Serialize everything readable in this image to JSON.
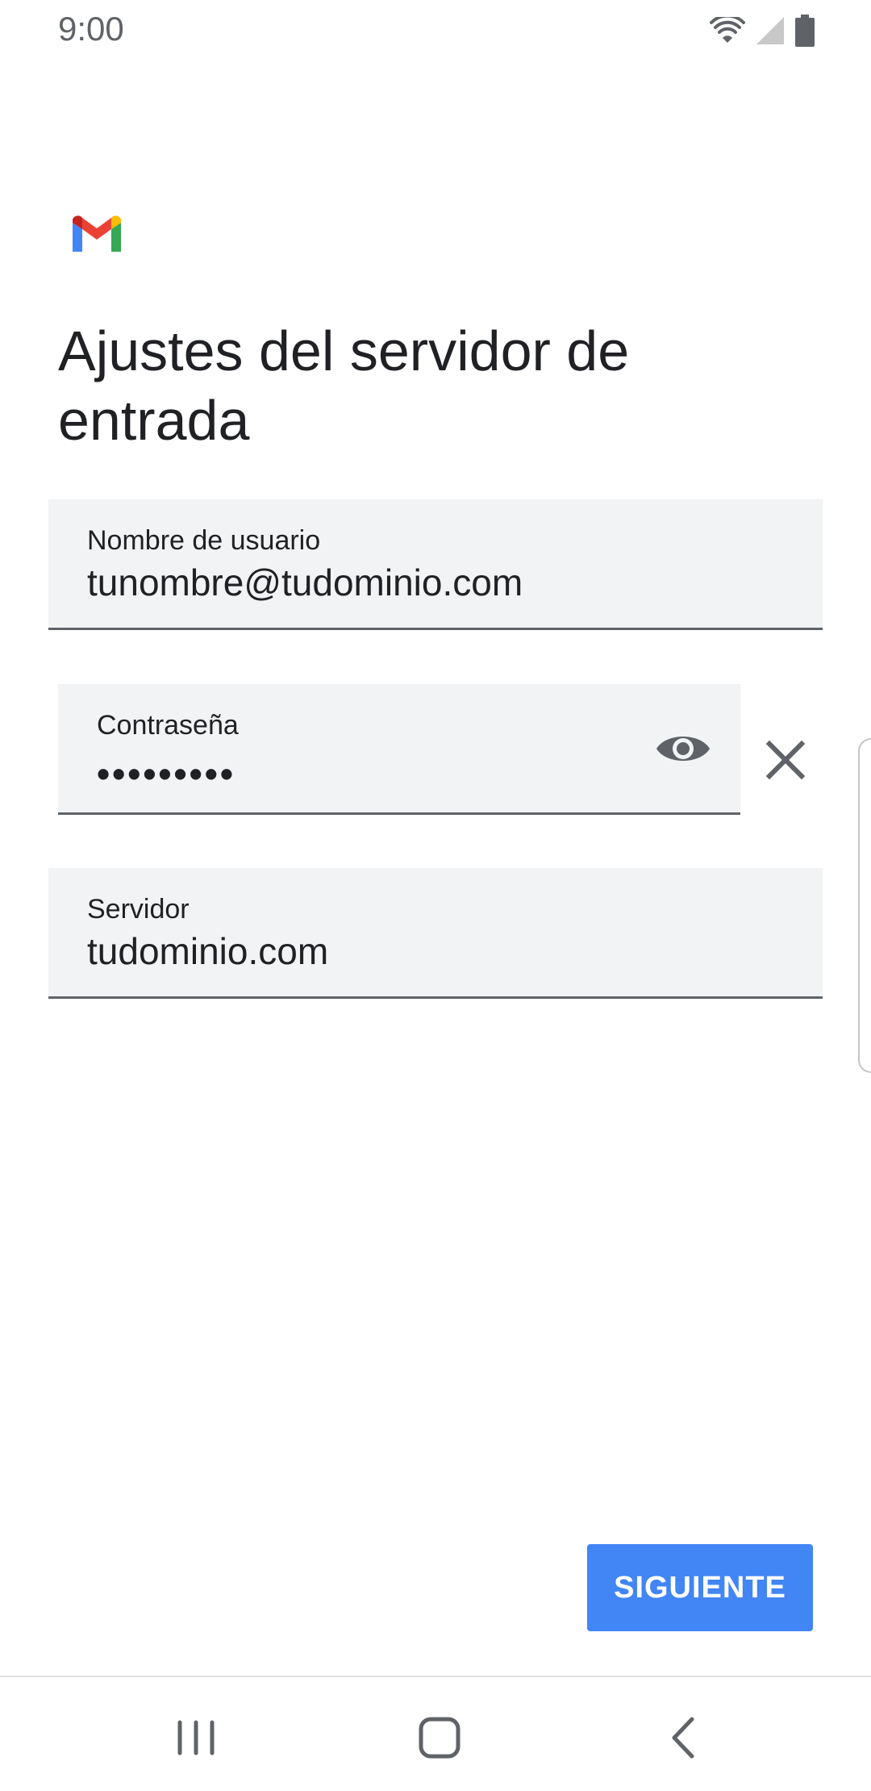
{
  "status_bar": {
    "time": "9:00",
    "icons": [
      "wifi-icon",
      "signal-icon",
      "battery-icon"
    ]
  },
  "app": {
    "logo": "gmail-logo",
    "title": "Ajustes del servidor de entrada"
  },
  "form": {
    "username": {
      "label": "Nombre de usuario",
      "value": "tunombre@tudominio.com"
    },
    "password": {
      "label": "Contraseña",
      "masked_value": "•••••••••",
      "toggle_icon": "eye-icon",
      "clear_icon": "close-icon"
    },
    "server": {
      "label": "Servidor",
      "value": "tudominio.com"
    }
  },
  "actions": {
    "next_label": "SIGUIENTE"
  },
  "navigation": {
    "items": [
      "recents-icon",
      "home-icon",
      "back-icon"
    ]
  },
  "colors": {
    "accent": "#4285f4",
    "field_bg": "#f1f3f4",
    "text": "#202124",
    "secondary": "#5f6368"
  }
}
